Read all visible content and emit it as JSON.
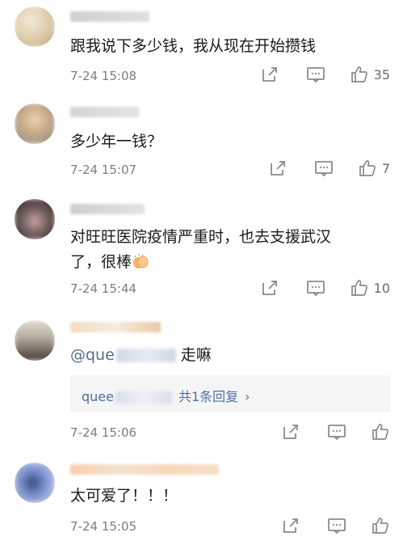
{
  "comments": [
    {
      "text": "跟我说下多少钱，我从现在开始攒钱",
      "time": "7-24 15:08",
      "likes": "35",
      "avatar_colors": [
        "#efe4cf",
        "#d9c6a3",
        "#b8a58a"
      ],
      "name_colors": [
        "#cfcfcf",
        "#dcdcdc"
      ]
    },
    {
      "text": "多少年一钱？",
      "time": "7-24 15:07",
      "likes": "7",
      "avatar_colors": [
        "#e9c9a8",
        "#c7a787",
        "#9a8a7a"
      ],
      "name_colors": [
        "#d4d4d4",
        "#e0e0e0"
      ]
    },
    {
      "text_line1": "对旺旺医院疫情严重时，也去支援武汉",
      "text_line2": "了，很棒",
      "time": "7-24 15:44",
      "likes": "10",
      "avatar_colors": [
        "#6e5b5b",
        "#c9a3a3",
        "#3a2e2e"
      ],
      "name_colors": [
        "#cfcfcf",
        "#e3e3e3"
      ]
    },
    {
      "mention_prefix": "@que",
      "text_suffix": "走嘛",
      "reply_user": "quee",
      "reply_link": "共1条回复",
      "time": "7-24 15:06",
      "avatar_colors": [
        "#b8b0a3",
        "#4a3c33",
        "#e5ddd2"
      ],
      "name_colors": [
        "#f0dcc0",
        "#f5e8d8"
      ]
    },
    {
      "text": "太可爱了！！！",
      "time": "7-24 15:05",
      "avatar_colors": [
        "#b6c7ee",
        "#3a4a80",
        "#d5def5"
      ],
      "name_colors": [
        "#f7cdb0",
        "#f3e0c7"
      ]
    }
  ]
}
